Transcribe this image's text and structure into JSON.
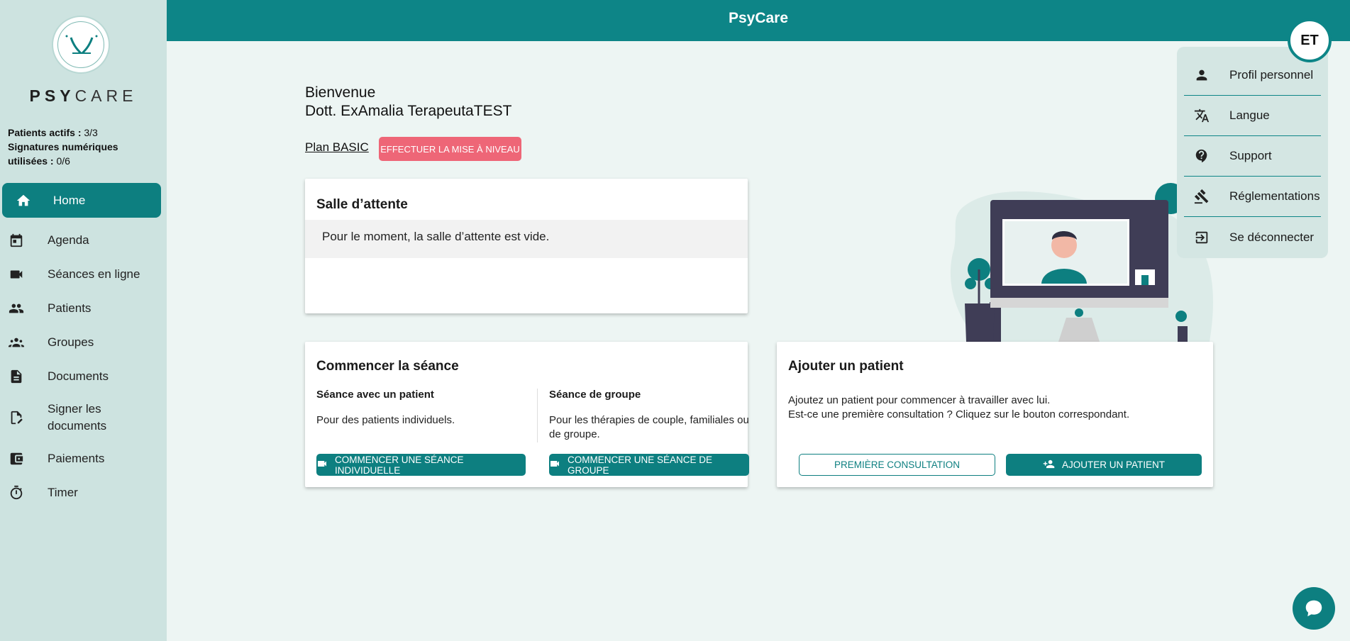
{
  "app": {
    "title": "PsyCare",
    "brand_bold": "PSY",
    "brand_rest": "CARE"
  },
  "user": {
    "initials": "ET"
  },
  "stats": {
    "patients_label": "Patients actifs :",
    "patients_value": "3/3",
    "signatures_label_1": "Signatures numériques",
    "signatures_label_2": "utilisées :",
    "signatures_value": "0/6"
  },
  "sidebar": {
    "items": [
      {
        "label": "Home",
        "icon": "home-icon"
      },
      {
        "label": "Agenda",
        "icon": "calendar-icon"
      },
      {
        "label": "Séances en ligne",
        "icon": "video-icon"
      },
      {
        "label": "Patients",
        "icon": "people-icon"
      },
      {
        "label": "Groupes",
        "icon": "groups-icon"
      },
      {
        "label": "Documents",
        "icon": "document-icon"
      },
      {
        "label": "Signer les documents",
        "icon": "sign-document-icon"
      },
      {
        "label": "Paiements",
        "icon": "wallet-icon"
      },
      {
        "label": "Timer",
        "icon": "timer-icon"
      }
    ]
  },
  "menu": {
    "items": [
      {
        "label": "Profil personnel",
        "icon": "person-icon"
      },
      {
        "label": "Langue",
        "icon": "translate-icon"
      },
      {
        "label": "Support",
        "icon": "help-icon"
      },
      {
        "label": "Réglementations",
        "icon": "gavel-icon"
      },
      {
        "label": "Se déconnecter",
        "icon": "logout-icon"
      }
    ]
  },
  "welcome": {
    "line1": "Bienvenue",
    "line2": "Dott. ExAmalia TerapeutaTEST"
  },
  "plan": {
    "label": "Plan BASIC",
    "upgrade_label": "EFFECTUER LA MISE À NIVEAU"
  },
  "waiting_room": {
    "title": "Salle d’attente",
    "empty_text": "Pour le moment, la salle d’attente est vide."
  },
  "session": {
    "title": "Commencer la séance",
    "individual": {
      "heading": "Séance avec un patient",
      "text": "Pour des patients individuels.",
      "button": "COMMENCER UNE SÉANCE INDIVIDUELLE"
    },
    "group": {
      "heading": "Séance de groupe",
      "text_1": "Pour les thérapies de couple, familiales ou",
      "text_2": "de groupe.",
      "button": "COMMENCER UNE SÉANCE DE GROUPE"
    }
  },
  "add_patient": {
    "title": "Ajouter un patient",
    "text_1": "Ajoutez un patient pour commencer à travailler avec lui.",
    "text_2": "Est-ce une première consultation ? Cliquez sur le bouton correspondant.",
    "first_consult_button": "PREMIÈRE CONSULTATION",
    "add_button": "AJOUTER UN PATIENT"
  },
  "colors": {
    "primary": "#0d8587",
    "sidebar_bg": "#cde3e0",
    "upgrade": "#ee6677",
    "page_bg": "#edf5f3"
  }
}
